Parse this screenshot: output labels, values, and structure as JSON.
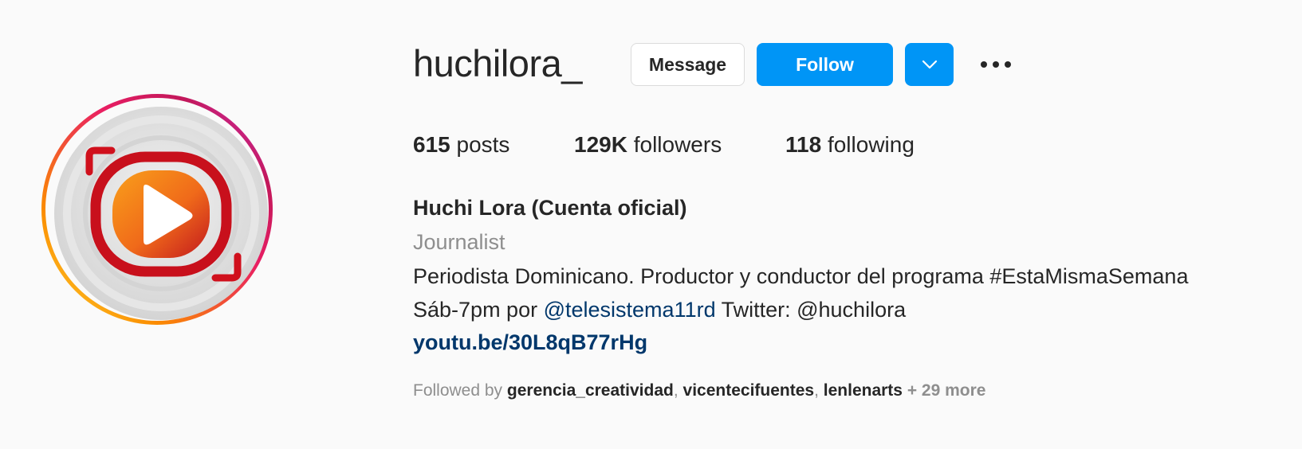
{
  "profile": {
    "username": "huchilora_",
    "full_name": "Huchi Lora (Cuenta oficial)",
    "category": "Journalist",
    "bio_line1": "Periodista Dominicano. Productor y conductor del programa #EstaMismaSemana",
    "bio_line2_prefix": "Sáb-7pm por ",
    "bio_line2_mention": "@telesistema11rd",
    "bio_line2_suffix": " Twitter: @huchilora",
    "link": "youtu.be/30L8qB77rHg"
  },
  "actions": {
    "message_label": "Message",
    "follow_label": "Follow",
    "dropdown_icon": "chevron-down-icon",
    "more_icon": "more-options-icon"
  },
  "stats": {
    "posts_count": "615",
    "posts_label": "posts",
    "followers_count": "129K",
    "followers_label": "followers",
    "following_count": "118",
    "following_label": "following"
  },
  "followed_by": {
    "prefix": "Followed by ",
    "accounts": [
      "gerencia_creatividad",
      "vicentecifuentes",
      "lenlenarts"
    ],
    "separator": ", ",
    "more": " + 29 more"
  },
  "colors": {
    "accent": "#0095f6",
    "link": "#00376b",
    "muted": "#8e8e8e",
    "text": "#262626",
    "background": "#fafafa"
  }
}
